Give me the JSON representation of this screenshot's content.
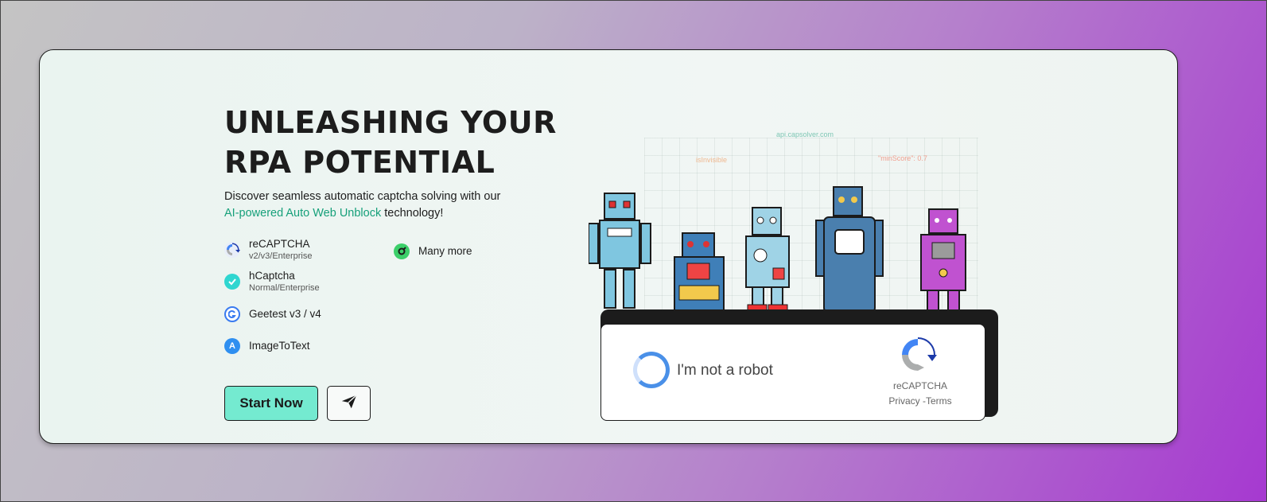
{
  "hero": {
    "title_line1": "UNLEASHING YOUR",
    "title_line2": "RPA POTENTIAL",
    "subtitle_pre": "Discover seamless automatic captcha solving with our",
    "subtitle_accent": "AI-powered Auto Web Unblock",
    "subtitle_post": " technology!",
    "accent_color": "#16a07a"
  },
  "features": [
    {
      "name": "reCAPTCHA",
      "sub": "v2/v3/Enterprise",
      "icon": "recaptcha-icon"
    },
    {
      "name": "hCaptcha",
      "sub": "Normal/Enterprise",
      "icon": "hcaptcha-icon"
    },
    {
      "name": "Geetest v3 / v4",
      "sub": "",
      "icon": "geetest-icon"
    },
    {
      "name": "ImageToText",
      "sub": "",
      "icon": "imagetotext-icon"
    },
    {
      "name": "Many more",
      "sub": "",
      "icon": "many-more-icon"
    }
  ],
  "buttons": {
    "start_label": "Start Now",
    "start_color": "#74ead0",
    "send_icon": "paper-plane-icon"
  },
  "code_labels": {
    "api": "api.capsolver.com",
    "invisible": "isInvisible",
    "min_score": "\"minScore\": 0.7"
  },
  "captcha": {
    "checkbox_label": "I'm not a robot",
    "brand": "reCAPTCHA",
    "links": "Privacy -Terms"
  }
}
